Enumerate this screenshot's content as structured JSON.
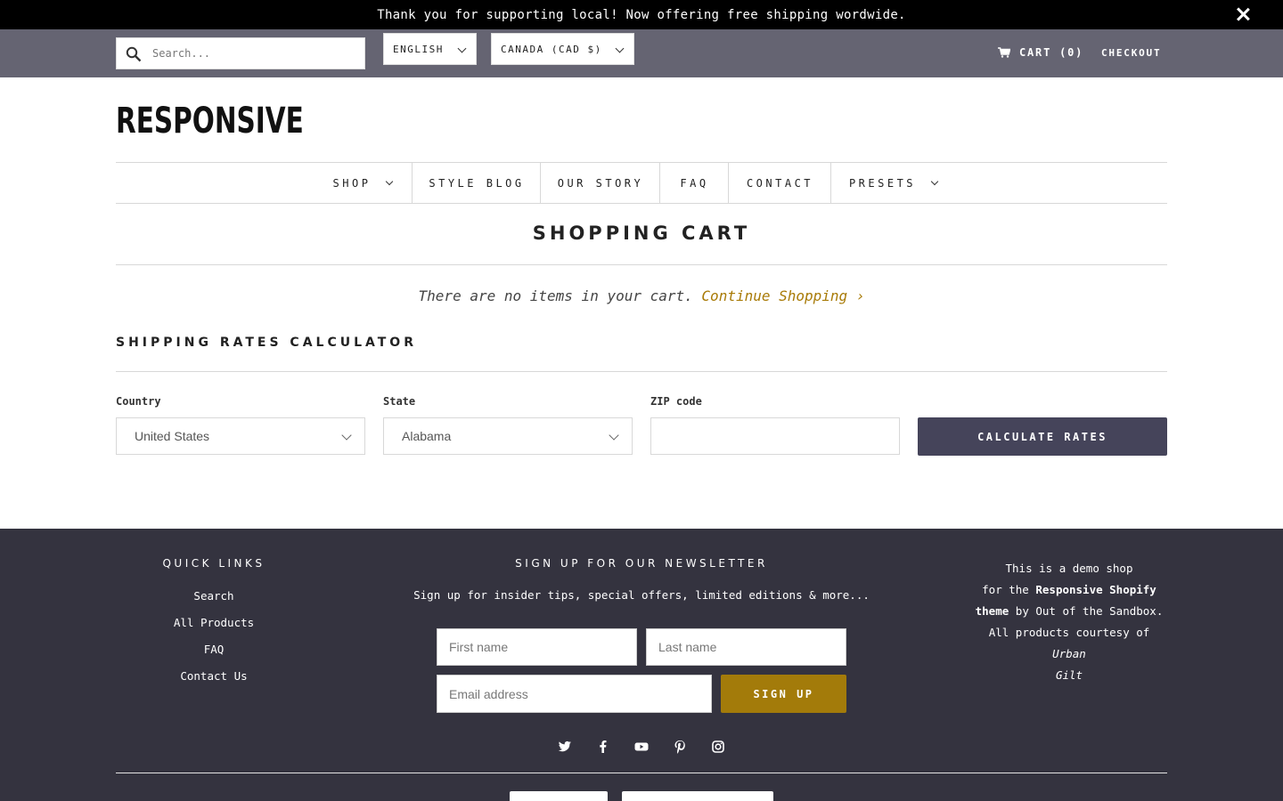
{
  "announcement": {
    "text": "Thank you for supporting local! Now offering free shipping wordwide."
  },
  "topbar": {
    "search_placeholder": "Search...",
    "language": "ENGLISH",
    "currency": "CANADA (CAD $)",
    "cart_label": "CART (0)",
    "checkout_label": "CHECKOUT"
  },
  "brand": {
    "logo": "RESPONSIVE"
  },
  "nav": {
    "items": [
      {
        "label": "SHOP"
      },
      {
        "label": "STYLE BLOG"
      },
      {
        "label": "OUR STORY"
      },
      {
        "label": "FAQ"
      },
      {
        "label": "CONTACT"
      },
      {
        "label": "PRESETS"
      }
    ]
  },
  "cart": {
    "title": "SHOPPING CART",
    "empty_message": "There are no items in your cart.",
    "continue_label": "Continue Shopping"
  },
  "shipping": {
    "title": "SHIPPING RATES CALCULATOR",
    "country_label": "Country",
    "country_value": "United States",
    "state_label": "State",
    "state_value": "Alabama",
    "zip_label": "ZIP code",
    "zip_value": "",
    "button": "CALCULATE RATES"
  },
  "footer": {
    "quick_links_title": "QUICK LINKS",
    "quick_links": [
      "Search",
      "All Products",
      "FAQ",
      "Contact Us"
    ],
    "newsletter_title": "SIGN UP FOR OUR NEWSLETTER",
    "newsletter_sub": "Sign up for insider tips, special offers, limited editions & more...",
    "first_name_placeholder": "First name",
    "last_name_placeholder": "Last name",
    "email_placeholder": "Email address",
    "signup_button": "SIGN UP",
    "social_icons": [
      "twitter-icon",
      "facebook-icon",
      "youtube-icon",
      "pinterest-icon",
      "instagram-icon"
    ],
    "about": {
      "line1": "This is a demo shop",
      "line2_pre": "for the ",
      "line2_bold": "Responsive Shopify",
      "line3_bold": "theme",
      "line3_post": " by Out of the Sandbox.",
      "line4": "All products courtesy of ",
      "line4_italic": "Urban",
      "line5_italic": "Gilt"
    }
  },
  "colors": {
    "announcement_bg": "#000000",
    "topbar_bg": "#656472",
    "accent_gold": "#a87a06",
    "button_dark": "#45445a",
    "footer_bg": "#34333f"
  }
}
